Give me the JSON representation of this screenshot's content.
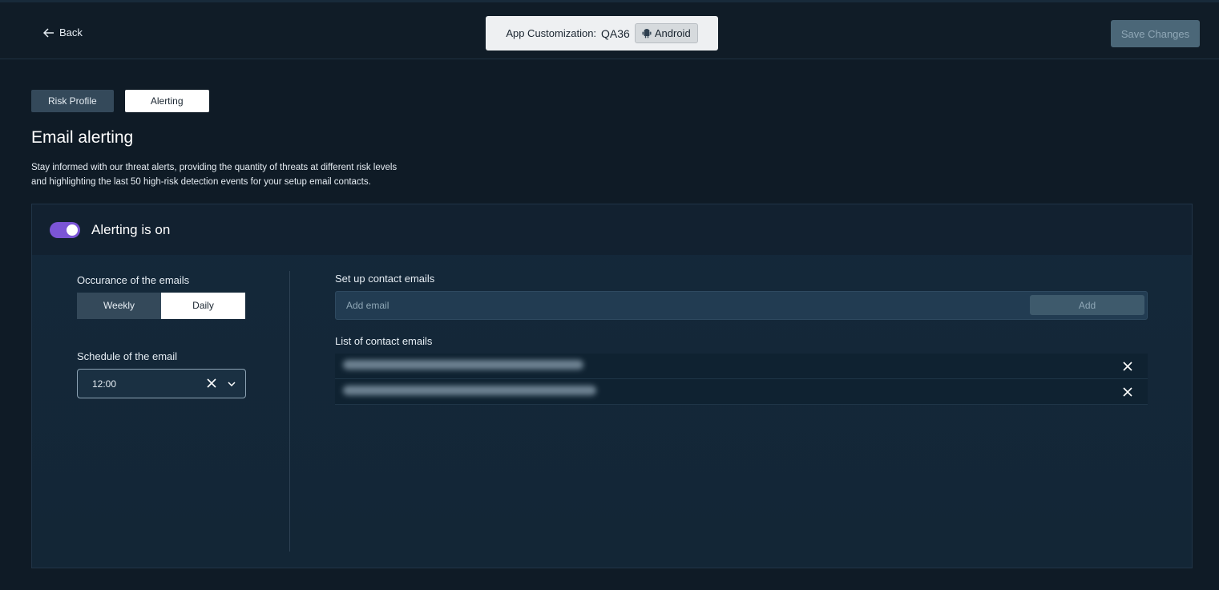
{
  "header": {
    "back_label": "Back",
    "app_customization_label": "App Customization:",
    "app_name": "QA36",
    "platform_label": "Android",
    "save_label": "Save Changes"
  },
  "tabs": [
    {
      "label": "Risk Profile",
      "active": false
    },
    {
      "label": "Alerting",
      "active": true
    }
  ],
  "page": {
    "title": "Email alerting",
    "description_line1": "Stay informed with our threat alerts, providing the quantity of threats at different risk levels",
    "description_line2": "and highlighting the last 50 high-risk detection events for your setup email contacts."
  },
  "alerting": {
    "toggle_on": true,
    "toggle_label": "Alerting is on",
    "accent_color": "#7b55d6"
  },
  "occurrence": {
    "label": "Occurance of the emails",
    "options": [
      "Weekly",
      "Daily"
    ],
    "selected": "Daily"
  },
  "schedule": {
    "label": "Schedule of the email",
    "value": "12:00"
  },
  "contacts": {
    "setup_label": "Set up contact emails",
    "input_placeholder": "Add email",
    "add_label": "Add",
    "list_label": "List of contact emails",
    "emails_redacted": 2
  },
  "icons": {
    "back": "arrow-left-icon",
    "platform": "android-icon",
    "clear": "close-icon",
    "dropdown": "chevron-down-icon",
    "remove": "close-icon"
  }
}
